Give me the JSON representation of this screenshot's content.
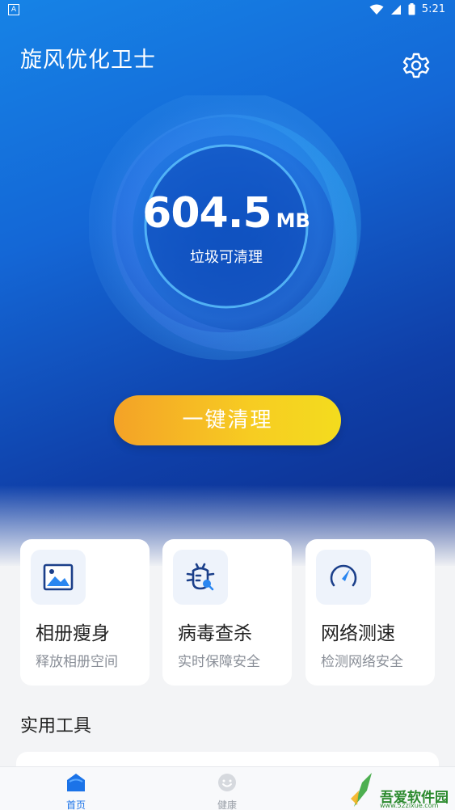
{
  "status_bar": {
    "left_icon": "A",
    "time": "5:21",
    "icons": [
      "wifi-icon",
      "signal-icon",
      "battery-icon"
    ]
  },
  "app": {
    "title": "旋风优化卫士",
    "settings_icon": "gear-icon"
  },
  "junk": {
    "value": "604.5",
    "unit": "MB",
    "label": "垃圾可清理"
  },
  "clean_button": {
    "label": "一键清理"
  },
  "features": [
    {
      "title": "相册瘦身",
      "subtitle": "释放相册空间",
      "icon": "image-icon"
    },
    {
      "title": "病毒查杀",
      "subtitle": "实时保障安全",
      "icon": "bug-icon"
    },
    {
      "title": "网络测速",
      "subtitle": "检测网络安全",
      "icon": "speedometer-icon"
    }
  ],
  "tools_section": {
    "title": "实用工具"
  },
  "tabbar": {
    "tabs": [
      {
        "label": "首页",
        "icon": "home-icon",
        "active": true
      },
      {
        "label": "健康",
        "icon": "smile-icon",
        "active": false
      }
    ]
  },
  "watermark": {
    "text": "吾爱软件园",
    "url_text": "www.52zixue.com"
  },
  "colors": {
    "accent": "#1b73e8",
    "button_start": "#f4a227",
    "button_end": "#f3dc1e",
    "hero_top": "#1683e6",
    "hero_bottom": "#0c2a86"
  }
}
